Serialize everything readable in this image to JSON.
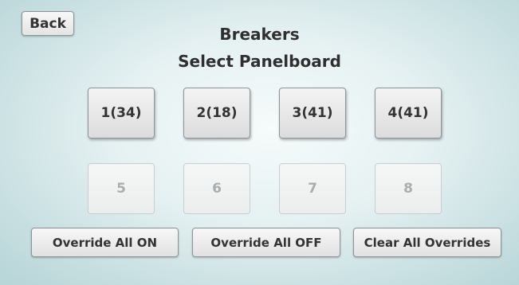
{
  "header": {
    "back_label": "Back",
    "title": "Breakers",
    "subtitle": "Select Panelboard"
  },
  "panels": {
    "p1": "1(34)",
    "p2": "2(18)",
    "p3": "3(41)",
    "p4": "4(41)",
    "p5": "5",
    "p6": "6",
    "p7": "7",
    "p8": "8"
  },
  "actions": {
    "override_on": "Override All ON",
    "override_off": "Override All OFF",
    "clear": "Clear All Overrides"
  }
}
